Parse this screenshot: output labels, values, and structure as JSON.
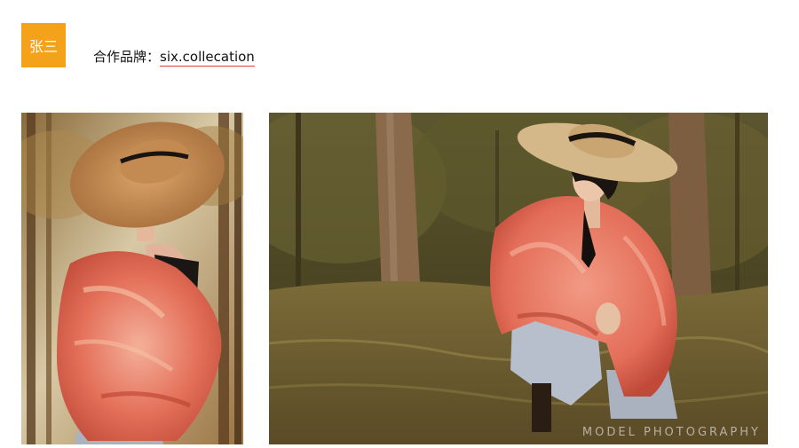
{
  "header": {
    "name_badge": "张三",
    "brand_label": "合作品牌：",
    "brand_value": "six.collecation"
  },
  "photos": {
    "left": {
      "subject": "model in wide straw hat and coral fur coat, side profile"
    },
    "right": {
      "subject": "model crouching in forest clearing wearing straw hat, coral fur coat and jeans"
    },
    "watermark": "MODEL PHOTOGRAPHY"
  },
  "colors": {
    "badge": "#f5a21b",
    "underline": "#e33c3c",
    "fur": "#e8735e",
    "hat": "#c98f55"
  }
}
